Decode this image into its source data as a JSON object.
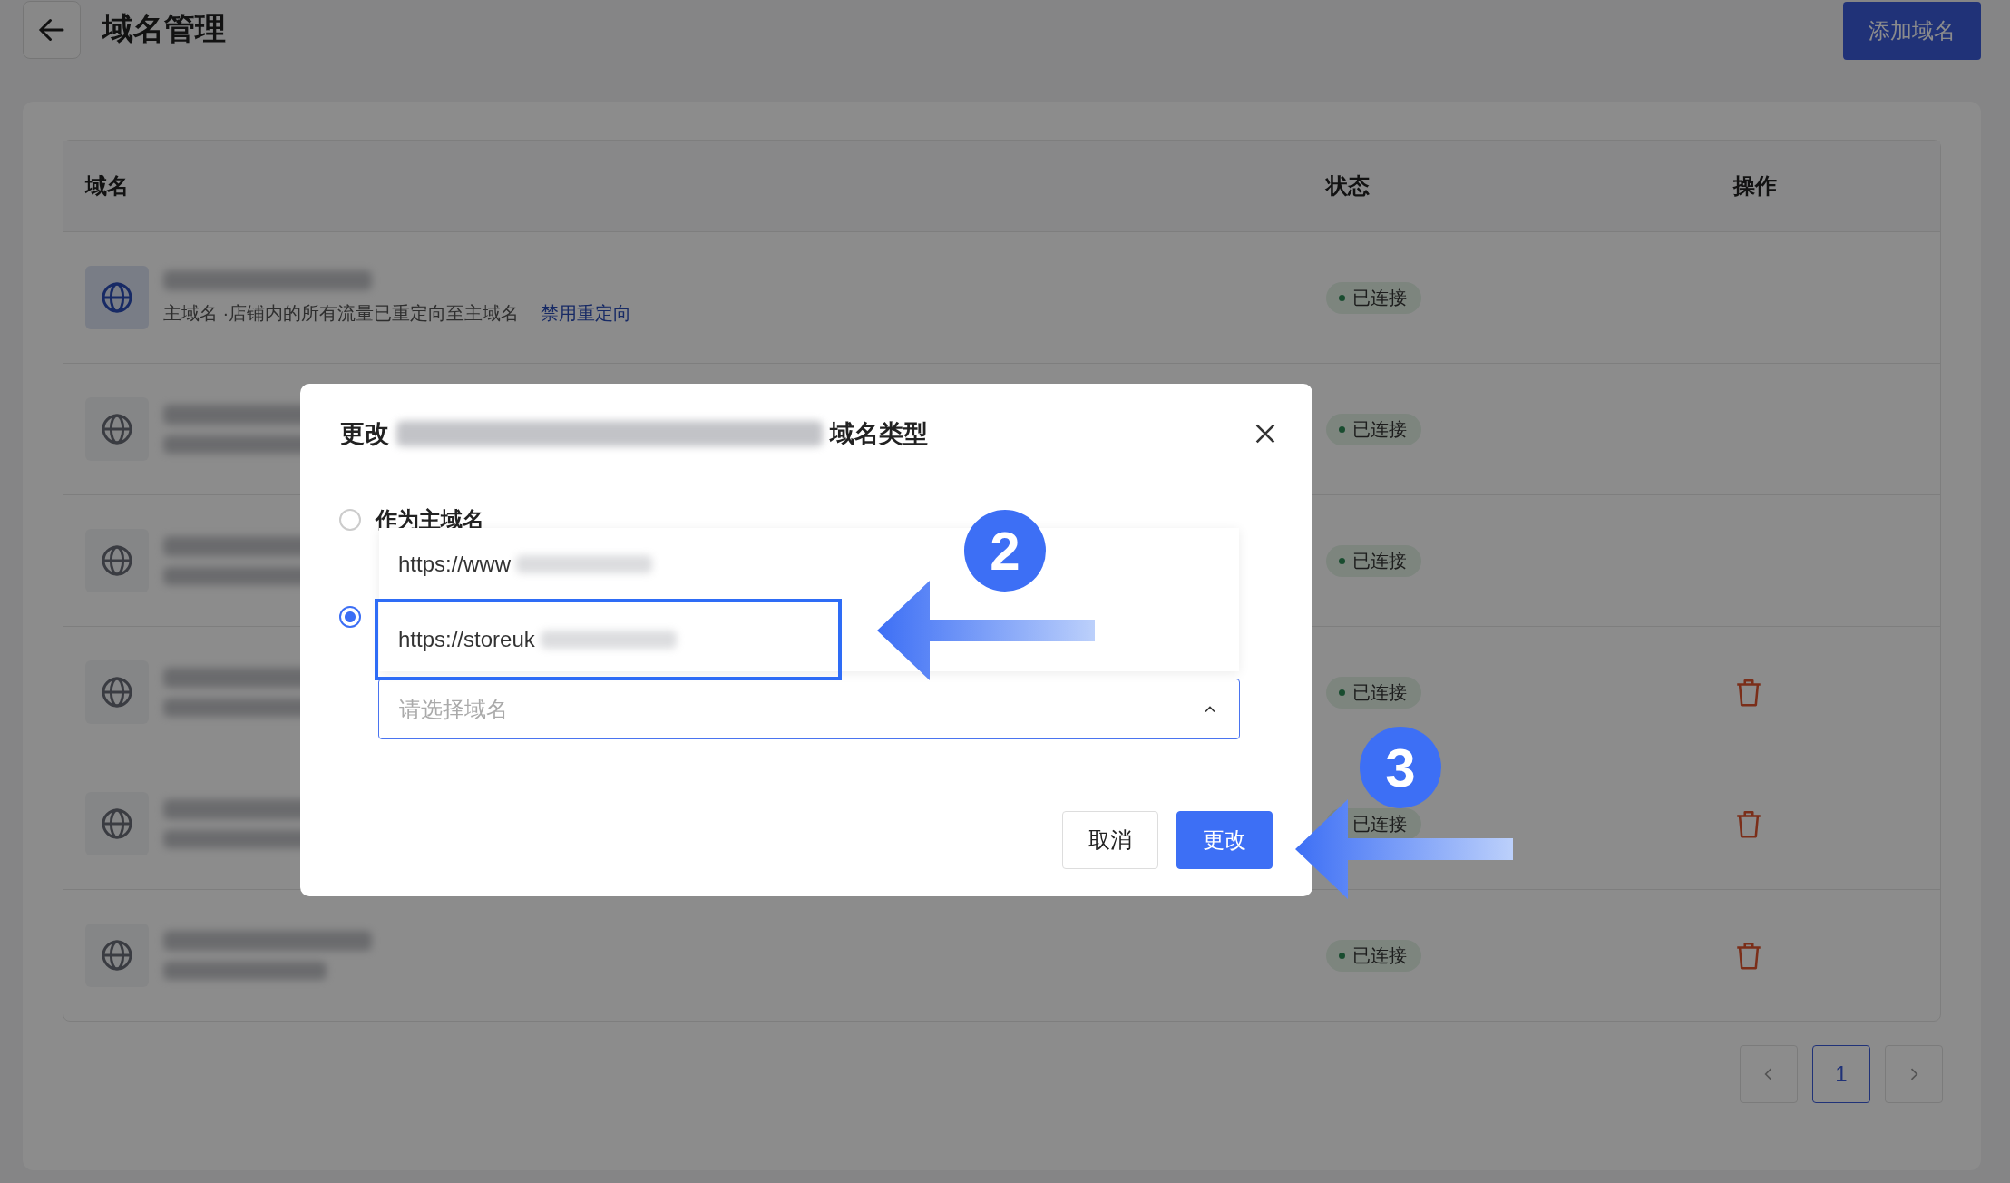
{
  "page": {
    "title": "域名管理",
    "add_button": "添加域名"
  },
  "table": {
    "columns": [
      "域名",
      "状态",
      "操作"
    ],
    "rows": [
      {
        "primary": true,
        "subtitle": "主域名 ·店铺内的所有流量已重定向至主域名",
        "link": "禁用重定向",
        "status": "已连接",
        "deletable": false
      },
      {
        "primary": false,
        "status": "已连接",
        "deletable": false
      },
      {
        "primary": false,
        "status": "已连接",
        "deletable": false
      },
      {
        "primary": false,
        "status": "已连接",
        "deletable": true
      },
      {
        "primary": false,
        "status": "已连接",
        "deletable": true
      },
      {
        "primary": false,
        "status": "已连接",
        "deletable": true
      }
    ]
  },
  "pagination": {
    "pages": [
      {
        "label": "1",
        "selected": true
      }
    ]
  },
  "dialog": {
    "title_before": "更改",
    "title_after": "域名类型",
    "options": [
      {
        "label": "作为主域名",
        "selected": false
      },
      {
        "selected": true
      }
    ],
    "dropdown": {
      "items": [
        {
          "label": "https://www",
          "selected": false
        },
        {
          "label": "https://storeuk",
          "selected": true
        }
      ]
    },
    "select": {
      "placeholder": "请选择域名",
      "expanded": true
    },
    "buttons": [
      {
        "label": "取消",
        "kind": "secondary"
      },
      {
        "label": "更改",
        "kind": "primary"
      }
    ]
  },
  "annotations": [
    {
      "label": "2"
    },
    {
      "label": "3"
    }
  ]
}
